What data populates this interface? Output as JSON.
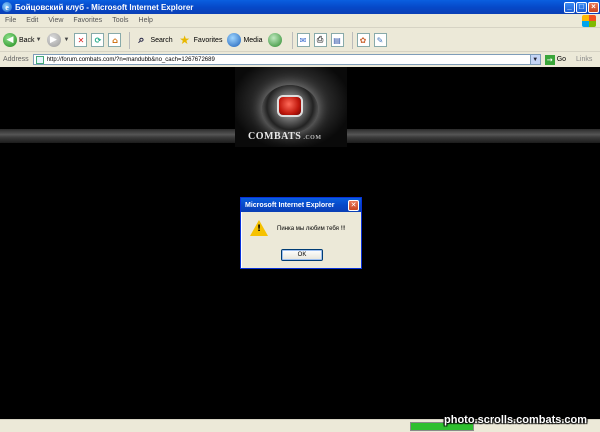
{
  "window": {
    "title": "Бойцовский клуб - Microsoft Internet Explorer",
    "controls": [
      "_",
      "□",
      "×"
    ]
  },
  "menu": [
    "File",
    "Edit",
    "View",
    "Favorites",
    "Tools",
    "Help"
  ],
  "toolbar": {
    "back_label": "Back",
    "search_label": "Search",
    "favorites_label": "Favorites",
    "media_label": "Media"
  },
  "address_bar": {
    "label": "Address",
    "url": "http://forum.combats.com/?n=mandubb&no_cach=1267672689",
    "go_label": "Go",
    "links_label": "Links"
  },
  "site": {
    "wordmark": "COMBATS",
    "wordmark_suffix": ".COM"
  },
  "dialog": {
    "title": "Microsoft Internet Explorer",
    "message": "Пинка мы любим тебя !!!",
    "ok_label": "OK"
  },
  "status_bar": {
    "progress": 1.0
  },
  "watermark": "photo.scrolls.combats.com",
  "colors": {
    "titlebar": "#0a5fe0",
    "page_background": "#000000",
    "warning_icon": "#f6c200",
    "brand_red": "#c0180d"
  }
}
